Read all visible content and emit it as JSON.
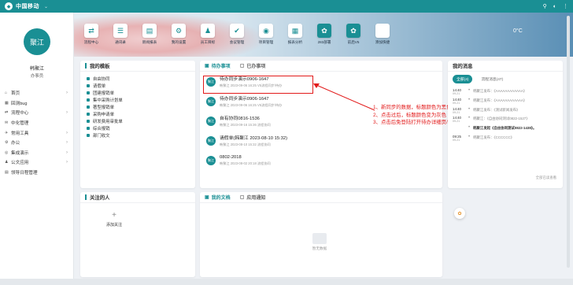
{
  "topbar": {
    "brand": "中国移动",
    "icons": [
      "search-icon",
      "user-icon",
      "settings-icon"
    ]
  },
  "apps": [
    {
      "label": "流程中心",
      "icon": "⇄"
    },
    {
      "label": "通讯录",
      "icon": "☰"
    },
    {
      "label": "新闻报表",
      "icon": "▤"
    },
    {
      "label": "我的设置",
      "icon": "⚙"
    },
    {
      "label": "员工目标",
      "icon": "♟"
    },
    {
      "label": "会议管理",
      "icon": "✔"
    },
    {
      "label": "项目管理",
      "icon": "◉"
    },
    {
      "label": "报表分析",
      "icon": "▦"
    },
    {
      "label": "283部署",
      "icon": "✿",
      "teal": true
    },
    {
      "label": "前后V5",
      "icon": "✿",
      "teal": true
    },
    {
      "label": "添加快捷",
      "icon": ""
    }
  ],
  "temperature": "0°C",
  "user": {
    "avatar": "聚江",
    "name": "韩聚江",
    "role": "办事员"
  },
  "menu": [
    {
      "label": "首页",
      "icon": "⌂",
      "arrow": true
    },
    {
      "label": "回测bug",
      "icon": "▦",
      "arrow": false
    },
    {
      "label": "流程中心",
      "icon": "⇄",
      "arrow": true
    },
    {
      "label": "中化管理",
      "icon": "✉",
      "arrow": false
    },
    {
      "label": "常用工具",
      "icon": "✈",
      "arrow": true
    },
    {
      "label": "办公",
      "icon": "⚙",
      "arrow": true
    },
    {
      "label": "集成演示",
      "icon": "◎",
      "arrow": true
    },
    {
      "label": "公文应用",
      "icon": "♟",
      "arrow": true
    },
    {
      "label": "领导日程管理",
      "icon": "▤",
      "arrow": false
    }
  ],
  "templates": {
    "title": "我的模板",
    "items": [
      "自由协同",
      "请假单",
      "团建报销单",
      "集中采购计划单",
      "著型报销单",
      "采购申请单",
      "研发费用审批单",
      "综合报销",
      "部门收文"
    ]
  },
  "todo": {
    "tabs": [
      {
        "label": "待办事项",
        "active": true
      },
      {
        "label": "已办事项",
        "active": false
      }
    ],
    "items": [
      {
        "title": "待办同步演示0906-1647",
        "meta": "韩聚江  2023-09-06 16:25  V5流程同步/待办"
      },
      {
        "title": "待办同步演示0906-1647",
        "meta": "韩聚江  2023-09-06 16:25  V5流程同步/待办"
      },
      {
        "title": "自有协同0816-1536",
        "meta": "韩聚江  2023-09-16 15:36  流程协同"
      },
      {
        "title": "请假单(韩聚江 2023-08-10 15:32)",
        "meta": "韩聚江  2023-08-10 15:32  流程协同"
      },
      {
        "title": "0802-2018",
        "meta": "韩聚江  2023-08-02 20:18  流程协同"
      }
    ]
  },
  "annotation": [
    "1、新同步的数据，标题颜色为黑色",
    "2、点击过后，标题颜色变为灰色",
    "3、点击后免登陆打开待办详细页/待处理页"
  ],
  "messages": {
    "title": "我的消息",
    "tabs": [
      {
        "label": "全部(4)",
        "active": true
      },
      {
        "label": "流程消息(47)",
        "active": false
      }
    ],
    "items": [
      {
        "time": "14:40",
        "date": "09-21",
        "text": "韩聚江发布：《AAAAAAAAAAAA》",
        "bold": false
      },
      {
        "time": "14:40",
        "date": "09-21",
        "text": "韩聚江发布：《AAAAAAAAAAAA》",
        "bold": false
      },
      {
        "time": "14:40",
        "date": "09-21",
        "text": "韩聚江发布：《测试新闻发布》",
        "bold": false
      },
      {
        "time": "14:40",
        "date": "09-21",
        "text": "韩聚江：《自由协同测试0822-1527》",
        "bold": false
      },
      {
        "time": "",
        "date": "",
        "text": "韩聚江发起《自由协同测试0822-1438》。",
        "bold": true
      },
      {
        "time": "09:25",
        "date": "09-21",
        "text": "韩聚江发布：《CCCCCC》",
        "bold": false
      }
    ],
    "more": "全部已读查看"
  },
  "follow": {
    "title": "关注的人",
    "add_label": "添加关注"
  },
  "docs": {
    "tabs": [
      {
        "label": "我的文档",
        "active": true
      },
      {
        "label": "应用通知",
        "active": false
      }
    ],
    "empty": "暂无数据"
  },
  "colors": {
    "primary": "#1a8f94",
    "annotation": "#e21a1a"
  }
}
